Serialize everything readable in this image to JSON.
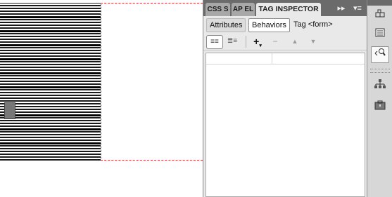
{
  "panel": {
    "tabs": [
      {
        "label": "CSS S",
        "active": false
      },
      {
        "label": "AP EL",
        "active": false
      },
      {
        "label": "TAG INSPECTOR",
        "active": true
      }
    ],
    "tab_controls": {
      "expand_glyph": "▸▸",
      "menu_glyph": "▾≡"
    },
    "subtabs": {
      "attributes": "Attributes",
      "behaviors": "Behaviors",
      "selected": "Behaviors"
    },
    "tag_label": "Tag <form>",
    "toolbar": {
      "show_set_events": "≡≡",
      "show_all_events": "≣≡",
      "add": "+",
      "add_caret": "▾",
      "remove": "−",
      "move_up": "▲",
      "move_down": "▼"
    },
    "behaviors_list": {
      "rows": []
    }
  },
  "strip": {
    "icons": [
      "insert-icon",
      "files-icon",
      "tag-inspector-icon",
      "sitemap-icon",
      "assets-icon"
    ]
  },
  "colors": {
    "guide": "#e0303a",
    "tabbar": "#6b6b6b",
    "panel_bg": "#e9e9e9"
  }
}
